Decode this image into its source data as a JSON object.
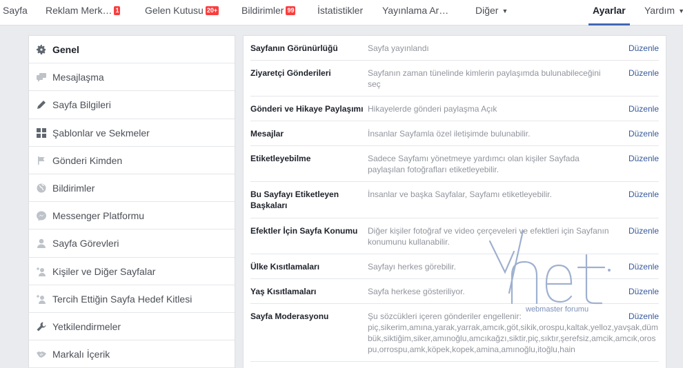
{
  "nav": {
    "items": [
      {
        "label": "Sayfa",
        "badge": ""
      },
      {
        "label": "Reklam Merk…",
        "badge": "1"
      },
      {
        "label": "Gelen Kutusu",
        "badge": "20+"
      },
      {
        "label": "Bildirimler",
        "badge": "99"
      },
      {
        "label": "İstatistikler",
        "badge": ""
      },
      {
        "label": "Yayınlama Ar…",
        "badge": ""
      },
      {
        "label": "Diğer",
        "badge": ""
      }
    ],
    "settings_label": "Ayarlar",
    "help_label": "Yardım"
  },
  "sidebar": {
    "items": [
      {
        "label": "Genel",
        "icon": "gear-icon"
      },
      {
        "label": "Mesajlaşma",
        "icon": "chat-bubbles-icon"
      },
      {
        "label": "Sayfa Bilgileri",
        "icon": "pencil-icon"
      },
      {
        "label": "Şablonlar ve Sekmeler",
        "icon": "grid-icon"
      },
      {
        "label": "Gönderi Kimden",
        "icon": "flag-icon"
      },
      {
        "label": "Bildirimler",
        "icon": "globe-icon"
      },
      {
        "label": "Messenger Platformu",
        "icon": "messenger-icon"
      },
      {
        "label": "Sayfa Görevleri",
        "icon": "person-icon"
      },
      {
        "label": "Kişiler ve Diğer Sayfalar",
        "icon": "person-add-icon"
      },
      {
        "label": "Tercih Ettiğin Sayfa Hedef Kitlesi",
        "icon": "person-add-icon"
      },
      {
        "label": "Yetkilendirmeler",
        "icon": "wrench-icon"
      },
      {
        "label": "Markalı İçerik",
        "icon": "handshake-icon"
      }
    ]
  },
  "settings": {
    "edit_label": "Düzenle",
    "rows": [
      {
        "label": "Sayfanın Görünürlüğü",
        "value": "Sayfa yayınlandı"
      },
      {
        "label": "Ziyaretçi Gönderileri",
        "value": "Sayfanın zaman tünelinde kimlerin paylaşımda bulunabileceğini seç"
      },
      {
        "label": "Gönderi ve Hikaye Paylaşımı",
        "value": "Hikayelerde gönderi paylaşma Açık"
      },
      {
        "label": "Mesajlar",
        "value": "İnsanlar Sayfamla özel iletişimde bulunabilir."
      },
      {
        "label": "Etiketleyebilme",
        "value": "Sadece Sayfamı yönetmeye yardımcı olan kişiler Sayfada paylaşılan fotoğrafları etiketleyebilir."
      },
      {
        "label": "Bu Sayfayı Etiketleyen Başkaları",
        "value": "İnsanlar ve başka Sayfalar, Sayfamı etiketleyebilir."
      },
      {
        "label": "Efektler İçin Sayfa Konumu",
        "value": "Diğer kişiler fotoğraf ve video çerçeveleri ve efektleri için Sayfanın konumunu kullanabilir."
      },
      {
        "label": "Ülke Kısıtlamaları",
        "value": "Sayfayı herkes görebilir."
      },
      {
        "label": "Yaş Kısıtlamaları",
        "value": "Sayfa herkese gösteriliyor."
      }
    ],
    "moderation": {
      "label": "Sayfa Moderasyonu",
      "intro": "Şu sözcükleri içeren gönderiler engellenir:",
      "words": "piç,sikerim,amına,yarak,yarrak,amcık,göt,sikik,orospu,kaltak,yelloz,yavşak,düm bük,siktiğim,siker,amınoğlu,amcıkağzı,siktir,piç,sıktır,şerefsiz,amcik,amcık,orospu,orrospu,amk,köpek,kopek,amina,amınoğlu,itoğlu,hain"
    }
  },
  "watermark": {
    "text": "webmaster forumu"
  }
}
